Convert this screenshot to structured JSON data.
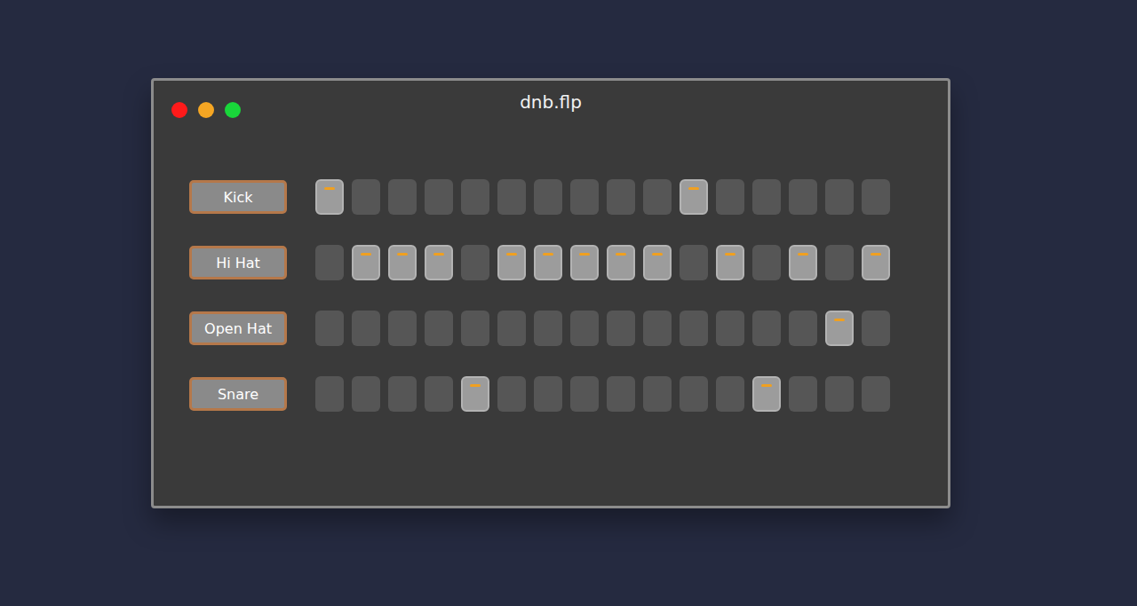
{
  "window": {
    "title": "dnb.flp"
  },
  "window_controls": [
    {
      "color": "#ff1a1a"
    },
    {
      "color": "#f5a623"
    },
    {
      "color": "#19d63a"
    }
  ],
  "tracks": [
    {
      "name": "Kick",
      "steps": [
        {
          "on": true
        },
        {
          "on": false
        },
        {
          "on": false
        },
        {
          "on": false
        },
        {
          "on": false
        },
        {
          "on": false
        },
        {
          "on": false
        },
        {
          "on": false
        },
        {
          "on": false
        },
        {
          "on": false
        },
        {
          "on": true
        },
        {
          "on": false
        },
        {
          "on": false
        },
        {
          "on": false
        },
        {
          "on": false
        },
        {
          "on": false
        }
      ]
    },
    {
      "name": "Hi Hat",
      "steps": [
        {
          "on": false
        },
        {
          "on": true
        },
        {
          "on": true
        },
        {
          "on": true
        },
        {
          "on": false
        },
        {
          "on": true
        },
        {
          "on": true
        },
        {
          "on": true
        },
        {
          "on": true
        },
        {
          "on": true
        },
        {
          "on": false
        },
        {
          "on": true
        },
        {
          "on": false
        },
        {
          "on": true
        },
        {
          "on": false
        },
        {
          "on": true
        }
      ]
    },
    {
      "name": "Open Hat",
      "steps": [
        {
          "on": false
        },
        {
          "on": false
        },
        {
          "on": false
        },
        {
          "on": false
        },
        {
          "on": false
        },
        {
          "on": false
        },
        {
          "on": false
        },
        {
          "on": false
        },
        {
          "on": false
        },
        {
          "on": false
        },
        {
          "on": false
        },
        {
          "on": false
        },
        {
          "on": false
        },
        {
          "on": false
        },
        {
          "on": true
        },
        {
          "on": false
        }
      ]
    },
    {
      "name": "Snare",
      "steps": [
        {
          "on": false
        },
        {
          "on": false
        },
        {
          "on": false
        },
        {
          "on": false
        },
        {
          "on": true
        },
        {
          "on": false
        },
        {
          "on": false
        },
        {
          "on": false
        },
        {
          "on": false
        },
        {
          "on": false
        },
        {
          "on": false
        },
        {
          "on": false
        },
        {
          "on": true
        },
        {
          "on": false
        },
        {
          "on": false
        },
        {
          "on": false
        }
      ]
    }
  ]
}
